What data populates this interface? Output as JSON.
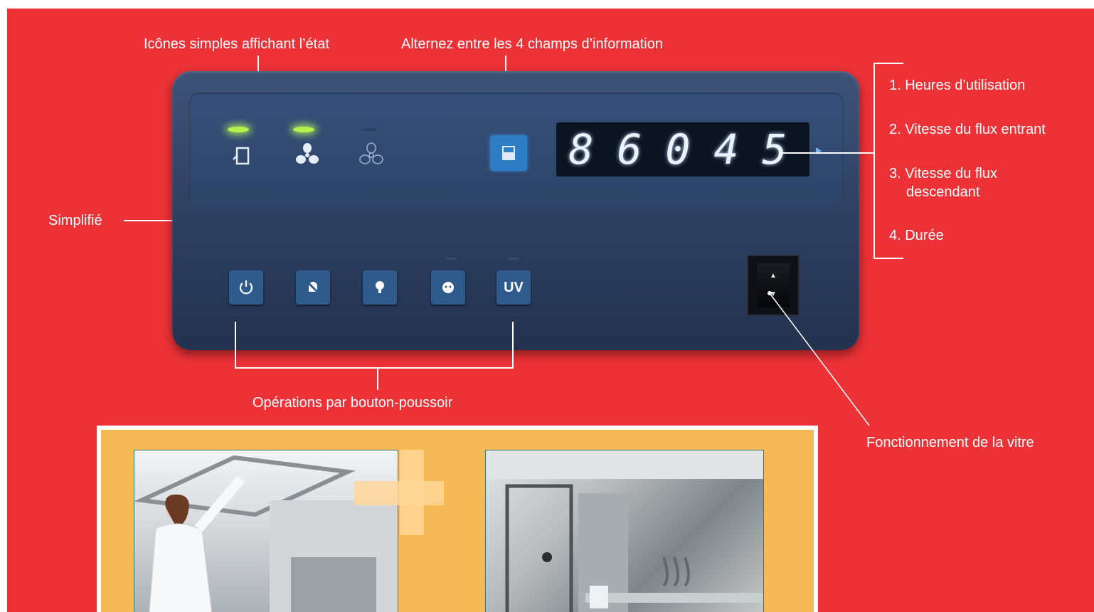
{
  "annotations": {
    "status_icons": "Icônes simples affichant l’état",
    "toggle_fields": "Alternez entre les 4 champs d’information",
    "simplified": "Simplifié",
    "push_buttons": "Opérations par bouton-poussoir",
    "sash_operation": "Fonctionnement de la vitre"
  },
  "info_fields": [
    "1. Heures d’utilisation",
    "2. Vitesse du flux entrant",
    "3. Vitesse du flux",
    "descendant",
    "4. Durée"
  ],
  "display": {
    "digits": [
      "8",
      "6",
      "0",
      "4",
      "5"
    ],
    "glow_color": "#e9f2ff"
  },
  "status_leds": [
    {
      "icon": "sash-icon",
      "on": true
    },
    {
      "icon": "fan-icon",
      "on": true
    },
    {
      "icon": "fan-outline-icon",
      "on": false
    }
  ],
  "buttons": [
    {
      "icon": "power-icon"
    },
    {
      "icon": "alarm-mute-icon"
    },
    {
      "icon": "light-bulb-icon"
    },
    {
      "icon": "outlet-icon"
    },
    {
      "icon": "uv-icon",
      "label": "UV"
    }
  ],
  "colors": {
    "background": "#ec3237",
    "panel": "#2d3f60",
    "accent_blue": "#2e7ec6",
    "photo_frame": "#f5ba55"
  }
}
